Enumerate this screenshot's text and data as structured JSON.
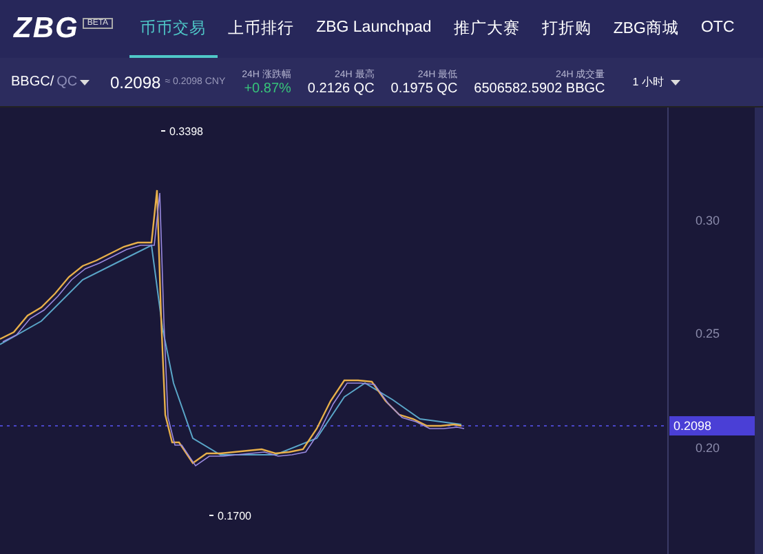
{
  "header": {
    "logo": "ZBG",
    "badge": "BETA",
    "nav": [
      {
        "label": "币币交易",
        "selected": true
      },
      {
        "label": "上币排行",
        "selected": false
      },
      {
        "label": "ZBG Launchpad",
        "selected": false
      },
      {
        "label": "推广大赛",
        "selected": false
      },
      {
        "label": "打折购",
        "selected": false
      },
      {
        "label": "ZBG商城",
        "selected": false
      },
      {
        "label": "OTC",
        "selected": false
      }
    ]
  },
  "ticker": {
    "base": "BBGC/",
    "quote": "QC",
    "price": "0.2098",
    "price_cny": "≈ 0.2098 CNY",
    "stats": [
      {
        "label": "24H 涨跌幅",
        "value": "+0.87%",
        "kind": "change"
      },
      {
        "label": "24H 最高",
        "value": "0.2126 QC",
        "kind": "plain"
      },
      {
        "label": "24H 最低",
        "value": "0.1975 QC",
        "kind": "plain"
      },
      {
        "label": "24H 成交量",
        "value": "6506582.5902 BBGC",
        "kind": "plain"
      }
    ],
    "interval": "1 小时"
  },
  "chart": {
    "high_marker": "0.3398",
    "low_marker": "0.1700",
    "price_tag": "0.2098",
    "axis_labels": [
      "0.30",
      "0.25",
      "0.20"
    ]
  }
}
